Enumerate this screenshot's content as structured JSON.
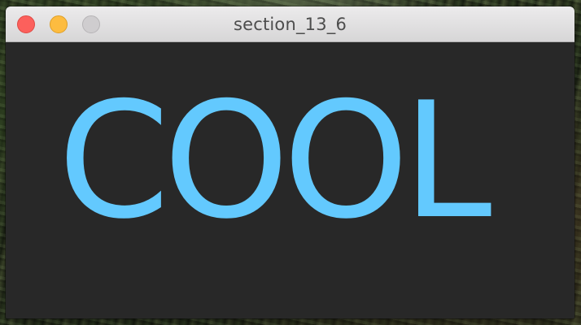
{
  "window": {
    "title": "section_13_6",
    "controls": {
      "close": "close-button",
      "minimize": "minimize-button",
      "zoom": "zoom-button"
    }
  },
  "content": {
    "text": "COOL",
    "text_color": "#63c9fe",
    "background_color": "#282828"
  }
}
